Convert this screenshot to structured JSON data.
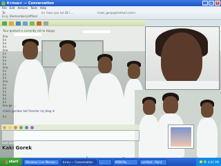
{
  "window": {
    "title": "ƙ×nuu× — Conversation",
    "controls": {
      "minimize": "_",
      "maximize": "□",
      "close": "×"
    }
  },
  "menu": {
    "items": [
      "File",
      "Edit",
      "Actions",
      "Tools",
      "Help"
    ]
  },
  "contact": {
    "to_label": "To:",
    "name": "ƙ×ŋ· (Remember)(offline)",
    "status": "ƙ× have you (at 28 / ...",
    "email": "<kaki_gonjo@hotmail.com>"
  },
  "history": {
    "lines": [
      "Your gesture is currently set to Happy",
      "ƙnu",
      "ƙ×",
      "ƙ×",
      "ƙ×",
      "ƙnu",
      "ƙ×",
      "ƙ×",
      "ƙ×",
      "ƙ×",
      "ƙnu",
      "ƙ×",
      "ƙ×",
      "ƙ×",
      "ƙnu",
      "ƙ×",
      "ƙ×",
      "ƙ×",
      "ƙ×",
      "ƙ×",
      "ƙ×",
      "ƙnu ge ...",
      "check gambar kat frenster my blog ni",
      "ƙ×"
    ]
  },
  "status_bar": {
    "text": "Last message received at ..."
  },
  "watermark": "Kaki Gorek",
  "taskbar": {
    "start_label": "start",
    "tasks": [
      {
        "label": "Windows Live Messen...",
        "active": false
      },
      {
        "label": "ƙ×nu — Conversation",
        "active": true
      },
      {
        "label": "...",
        "active": false
      },
      {
        "label": "MSN Mo...",
        "active": false
      },
      {
        "label": "untitled - Paint",
        "active": false
      }
    ],
    "clock": "4:01 PM"
  },
  "colors": {
    "titlebar": "#1d55c6",
    "toolbar": "#c9dba8",
    "taskbar": "#1f4fb8",
    "start": "#2f8a2b"
  }
}
